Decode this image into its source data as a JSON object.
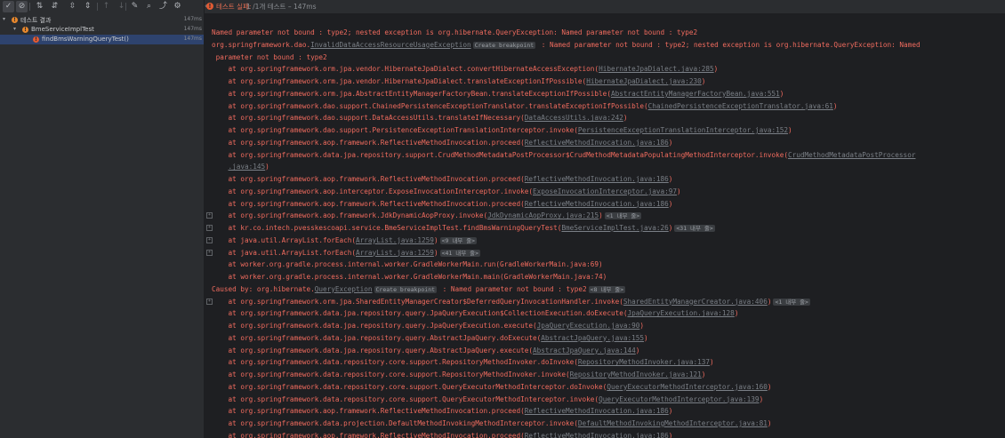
{
  "toolbar": {
    "buttons": [
      {
        "name": "show-passed-button",
        "icon": "check-icon",
        "glyph": "✓",
        "on": true
      },
      {
        "name": "show-ignored-button",
        "icon": "stop-circle-icon",
        "glyph": "⊘",
        "on": true
      },
      {
        "name": "sort-alphabetically-button",
        "icon": "sort-az-icon",
        "glyph": "⇅",
        "on": false
      },
      {
        "name": "sort-by-duration-button",
        "icon": "sort-duration-icon",
        "glyph": "⇵",
        "on": false
      },
      {
        "name": "expand-all-button",
        "icon": "expand-all-icon",
        "glyph": "⇳",
        "on": false
      },
      {
        "name": "collapse-all-button",
        "icon": "collapse-all-icon",
        "glyph": "⇕",
        "on": false
      },
      {
        "name": "previous-failed-button",
        "icon": "arrow-up-icon",
        "glyph": "↑",
        "dim": true
      },
      {
        "name": "next-failed-button",
        "icon": "arrow-down-icon",
        "glyph": "↓",
        "dim": true
      },
      {
        "name": "import-tests-button",
        "icon": "wrench-icon",
        "glyph": "✎",
        "on": false
      },
      {
        "name": "search-button",
        "icon": "search-icon",
        "glyph": "⌕",
        "on": false
      },
      {
        "name": "export-button",
        "icon": "export-icon",
        "glyph": "⤴",
        "on": false
      },
      {
        "name": "settings-button",
        "icon": "gear-icon",
        "glyph": "⚙",
        "on": false
      }
    ]
  },
  "status": {
    "chevron": "«",
    "icon": "!",
    "failed_label": "테스트 실패:",
    "count_text": "1 /1개 테스트 – 147ms"
  },
  "tree": [
    {
      "label": "테스트 결과",
      "time": "147ms",
      "indent": 0,
      "icon": "warning",
      "arrow": "▾"
    },
    {
      "label": "BmeServiceImplTest",
      "time": "147ms",
      "indent": 1,
      "icon": "warning",
      "arrow": "▾"
    },
    {
      "label": "findBmsWarningQueryTest()",
      "time": "147ms",
      "indent": 2,
      "icon": "error",
      "arrow": "",
      "selected": true
    }
  ],
  "console": [
    {
      "segs": [
        {
          "t": "Named parameter not bound : type2; nested exception is org.hibernate.QueryException: Named parameter not bound : type2"
        }
      ]
    },
    {
      "segs": [
        {
          "t": "org.springframework.dao."
        },
        {
          "t": "InvalidDataAccessResourceUsageException",
          "link": true
        },
        {
          "t": "Create breakpoint",
          "badge": true
        },
        {
          "t": " : Named parameter not bound : type2; nested exception is org.hibernate.QueryException: Named"
        }
      ]
    },
    {
      "segs": [
        {
          "t": " parameter not bound : type2"
        }
      ]
    },
    {
      "segs": [
        {
          "t": "    at org.springframework.orm.jpa.vendor.HibernateJpaDialect.convertHibernateAccessException("
        },
        {
          "t": "HibernateJpaDialect.java:285",
          "link": true
        },
        {
          "t": ")"
        }
      ]
    },
    {
      "segs": [
        {
          "t": "    at org.springframework.orm.jpa.vendor.HibernateJpaDialect.translateExceptionIfPossible("
        },
        {
          "t": "HibernateJpaDialect.java:230",
          "link": true
        },
        {
          "t": ")"
        }
      ]
    },
    {
      "segs": [
        {
          "t": "    at org.springframework.orm.jpa.AbstractEntityManagerFactoryBean.translateExceptionIfPossible("
        },
        {
          "t": "AbstractEntityManagerFactoryBean.java:551",
          "link": true
        },
        {
          "t": ")"
        }
      ]
    },
    {
      "segs": [
        {
          "t": "    at org.springframework.dao.support.ChainedPersistenceExceptionTranslator.translateExceptionIfPossible("
        },
        {
          "t": "ChainedPersistenceExceptionTranslator.java:61",
          "link": true
        },
        {
          "t": ")"
        }
      ]
    },
    {
      "segs": [
        {
          "t": "    at org.springframework.dao.support.DataAccessUtils.translateIfNecessary("
        },
        {
          "t": "DataAccessUtils.java:242",
          "link": true
        },
        {
          "t": ")"
        }
      ]
    },
    {
      "segs": [
        {
          "t": "    at org.springframework.dao.support.PersistenceExceptionTranslationInterceptor.invoke("
        },
        {
          "t": "PersistenceExceptionTranslationInterceptor.java:152",
          "link": true
        },
        {
          "t": ")"
        }
      ]
    },
    {
      "segs": [
        {
          "t": "    at org.springframework.aop.framework.ReflectiveMethodInvocation.proceed("
        },
        {
          "t": "ReflectiveMethodInvocation.java:186",
          "link": true
        },
        {
          "t": ")"
        }
      ]
    },
    {
      "segs": [
        {
          "t": "    at org.springframework.data.jpa.repository.support.CrudMethodMetadataPostProcessor$CrudMethodMetadataPopulatingMethodInterceptor.invoke("
        },
        {
          "t": "CrudMethodMetadataPostProcessor",
          "link": true
        }
      ]
    },
    {
      "segs": [
        {
          "t": "    "
        },
        {
          "t": ".java:145",
          "link": true
        },
        {
          "t": ")"
        }
      ]
    },
    {
      "segs": [
        {
          "t": "    at org.springframework.aop.framework.ReflectiveMethodInvocation.proceed("
        },
        {
          "t": "ReflectiveMethodInvocation.java:186",
          "link": true
        },
        {
          "t": ")"
        }
      ]
    },
    {
      "segs": [
        {
          "t": "    at org.springframework.aop.interceptor.ExposeInvocationInterceptor.invoke("
        },
        {
          "t": "ExposeInvocationInterceptor.java:97",
          "link": true
        },
        {
          "t": ")"
        }
      ]
    },
    {
      "segs": [
        {
          "t": "    at org.springframework.aop.framework.ReflectiveMethodInvocation.proceed("
        },
        {
          "t": "ReflectiveMethodInvocation.java:186",
          "link": true
        },
        {
          "t": ")"
        }
      ]
    },
    {
      "gutter": true,
      "segs": [
        {
          "t": "    at org.springframework.aop.framework.JdkDynamicAopProxy.invoke("
        },
        {
          "t": "JdkDynamicAopProxy.java:215",
          "link": true
        },
        {
          "t": ")"
        },
        {
          "t": "<1 내부 줄>",
          "badge": true
        }
      ]
    },
    {
      "gutter": true,
      "segs": [
        {
          "t": "    at kr.co.intech.pvesskescoapi.service.BmeServiceImplTest.findBmsWarningQueryTest("
        },
        {
          "t": "BmeServiceImplTest.java:26",
          "link": true
        },
        {
          "t": ")"
        },
        {
          "t": "<31 내부 줄>",
          "badge": true
        }
      ]
    },
    {
      "gutter": true,
      "segs": [
        {
          "t": "    at java.util.ArrayList.forEach("
        },
        {
          "t": "ArrayList.java:1259",
          "link": true
        },
        {
          "t": ")"
        },
        {
          "t": "<9 내부 줄>",
          "badge": true
        }
      ]
    },
    {
      "gutter": true,
      "segs": [
        {
          "t": "    at java.util.ArrayList.forEach("
        },
        {
          "t": "ArrayList.java:1259",
          "link": true
        },
        {
          "t": ")"
        },
        {
          "t": "<41 내부 줄>",
          "badge": true
        }
      ]
    },
    {
      "segs": [
        {
          "t": "    at worker.org.gradle.process.internal.worker.GradleWorkerMain.run(GradleWorkerMain.java:69)"
        }
      ]
    },
    {
      "segs": [
        {
          "t": "    at worker.org.gradle.process.internal.worker.GradleWorkerMain.main(GradleWorkerMain.java:74)"
        }
      ]
    },
    {
      "segs": [
        {
          "t": "Caused by: org.hibernate."
        },
        {
          "t": "QueryException",
          "link": true
        },
        {
          "t": "Create breakpoint",
          "badge": true
        },
        {
          "t": " : Named parameter not bound : type2"
        },
        {
          "t": "<8 내부 줄>",
          "badge": true
        }
      ]
    },
    {
      "gutter": true,
      "segs": [
        {
          "t": "    at org.springframework.orm.jpa.SharedEntityManagerCreator$DeferredQueryInvocationHandler.invoke("
        },
        {
          "t": "SharedEntityManagerCreator.java:406",
          "link": true
        },
        {
          "t": ")"
        },
        {
          "t": "<1 내부 줄>",
          "badge": true
        }
      ]
    },
    {
      "segs": [
        {
          "t": "    at org.springframework.data.jpa.repository.query.JpaQueryExecution$CollectionExecution.doExecute("
        },
        {
          "t": "JpaQueryExecution.java:128",
          "link": true
        },
        {
          "t": ")"
        }
      ]
    },
    {
      "segs": [
        {
          "t": "    at org.springframework.data.jpa.repository.query.JpaQueryExecution.execute("
        },
        {
          "t": "JpaQueryExecution.java:90",
          "link": true
        },
        {
          "t": ")"
        }
      ]
    },
    {
      "segs": [
        {
          "t": "    at org.springframework.data.jpa.repository.query.AbstractJpaQuery.doExecute("
        },
        {
          "t": "AbstractJpaQuery.java:155",
          "link": true
        },
        {
          "t": ")"
        }
      ]
    },
    {
      "segs": [
        {
          "t": "    at org.springframework.data.jpa.repository.query.AbstractJpaQuery.execute("
        },
        {
          "t": "AbstractJpaQuery.java:144",
          "link": true
        },
        {
          "t": ")"
        }
      ]
    },
    {
      "segs": [
        {
          "t": "    at org.springframework.data.repository.core.support.RepositoryMethodInvoker.doInvoke("
        },
        {
          "t": "RepositoryMethodInvoker.java:137",
          "link": true
        },
        {
          "t": ")"
        }
      ]
    },
    {
      "segs": [
        {
          "t": "    at org.springframework.data.repository.core.support.RepositoryMethodInvoker.invoke("
        },
        {
          "t": "RepositoryMethodInvoker.java:121",
          "link": true
        },
        {
          "t": ")"
        }
      ]
    },
    {
      "segs": [
        {
          "t": "    at org.springframework.data.repository.core.support.QueryExecutorMethodInterceptor.doInvoke("
        },
        {
          "t": "QueryExecutorMethodInterceptor.java:160",
          "link": true
        },
        {
          "t": ")"
        }
      ]
    },
    {
      "segs": [
        {
          "t": "    at org.springframework.data.repository.core.support.QueryExecutorMethodInterceptor.invoke("
        },
        {
          "t": "QueryExecutorMethodInterceptor.java:139",
          "link": true
        },
        {
          "t": ")"
        }
      ]
    },
    {
      "segs": [
        {
          "t": "    at org.springframework.aop.framework.ReflectiveMethodInvocation.proceed("
        },
        {
          "t": "ReflectiveMethodInvocation.java:186",
          "link": true
        },
        {
          "t": ")"
        }
      ]
    },
    {
      "segs": [
        {
          "t": "    at org.springframework.data.projection.DefaultMethodInvokingMethodInterceptor.invoke("
        },
        {
          "t": "DefaultMethodInvokingMethodInterceptor.java:81",
          "link": true
        },
        {
          "t": ")"
        }
      ]
    },
    {
      "segs": [
        {
          "t": "    at org.springframework.aop.framework.ReflectiveMethodInvocation.proceed("
        },
        {
          "t": "ReflectiveMethodInvocation.java:186",
          "link": true
        },
        {
          "t": ")"
        }
      ]
    }
  ]
}
